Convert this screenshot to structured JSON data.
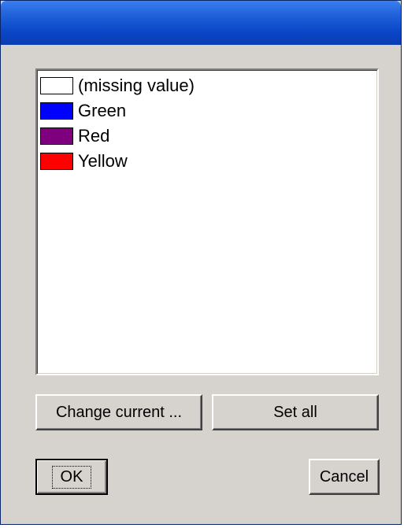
{
  "listbox": {
    "items": [
      {
        "label": "(missing value)",
        "color": "#ffffff"
      },
      {
        "label": "Green",
        "color": "#0000ff"
      },
      {
        "label": "Red",
        "color": "#7f007f"
      },
      {
        "label": "Yellow",
        "color": "#ff0000"
      }
    ]
  },
  "buttons": {
    "change_current": "Change current ...",
    "set_all": "Set all",
    "ok": "OK",
    "cancel": "Cancel"
  },
  "colors": {
    "titlebar": "#0a47c8",
    "dialog_face": "#d6d3ce"
  }
}
